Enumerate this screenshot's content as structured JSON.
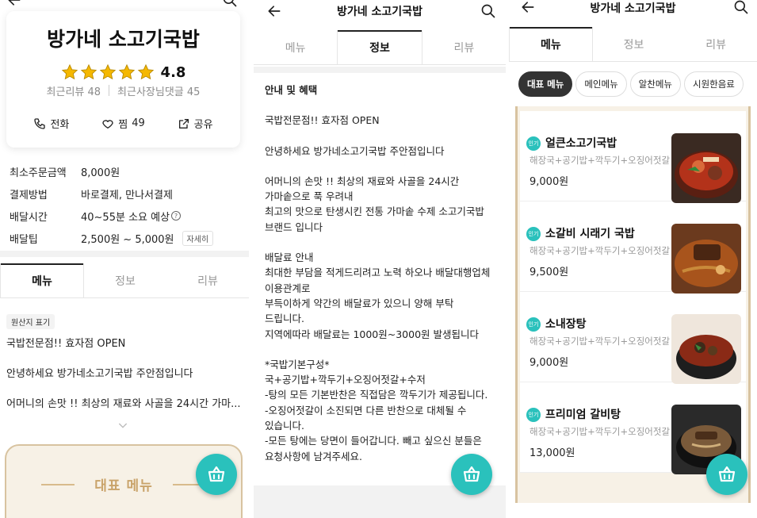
{
  "panel1": {
    "store_name": "방가네 소고기국밥",
    "rating": "4.8",
    "recent_reviews": "최근리뷰 48",
    "recent_owner_replies": "최근사장님댓글 45",
    "actions": {
      "call": "전화",
      "like": "찜",
      "like_count": "49",
      "share": "공유"
    },
    "info": [
      {
        "key": "최소주문금액",
        "value": "8,000원"
      },
      {
        "key": "결제방법",
        "value": "바로결제, 만나서결제"
      },
      {
        "key": "배달시간",
        "value": "40~55분 소요 예상"
      },
      {
        "key": "배달팁",
        "value": "2,500원 ~ 5,000원",
        "tag": "자세히"
      }
    ],
    "tabs": [
      "메뉴",
      "정보",
      "리뷰"
    ],
    "origin_tag": "원산지 표기",
    "notice": [
      "국밥전문점!!  효자점 OPEN",
      "안녕하세요 방가네소고기국밥  주안점입니다",
      "어머니의 손맛 !!  최상의 재료와 사골을 24시간 가마..."
    ],
    "banner_title": "대표 메뉴"
  },
  "panel2": {
    "header_title": "방가네 소고기국밥",
    "tabs": [
      "메뉴",
      "정보",
      "리뷰"
    ],
    "section_title": "안내 및 혜택",
    "paragraphs": [
      [
        "국밥전문점!!  효자점 OPEN"
      ],
      [
        "안녕하세요 방가네소고기국밥  주안점입니다"
      ],
      [
        "어머니의 손맛 !!  최상의 재료와 사골을 24시간",
        "가마솥으로 푹 우려내",
        "최고의 맛으로 탄생시킨 전통 가마솥 수제 소고기국밥",
        "브랜드 입니다"
      ],
      [
        "배달료 안내",
        "최대한 부담을 적게드리려고 노력 하오나 배달대행업체",
        "이용관계로",
        "부득이하게 약간의 배달료가 있으니 양해 부탁",
        "드립니다.",
        "지역에따라 배달료는 1000원~3000원 발생됩니다"
      ],
      [
        "*국밥기본구성*",
        "국+공기밥+깍두기+오징어젓갈+수저",
        "-탕의 모든 기본반찬은 직접담은 깍두기가 제공됩니다.",
        "-오징어젓갈이 소진되면 다른 반찬으로 대체될 수",
        "있습니다.",
        "-모든 탕에는 당면이 들어갑니다. 빼고 싶으신 분들은",
        "요청사항에 남겨주세요."
      ]
    ]
  },
  "panel3": {
    "header_title": "방가네 소고기국밥",
    "tabs": [
      "메뉴",
      "정보",
      "리뷰"
    ],
    "chips": [
      "대표 메뉴",
      "메인메뉴",
      "알찬메뉴",
      "시원한음료"
    ],
    "badge": "인기",
    "menu": [
      {
        "name": "얼큰소고기국밥",
        "desc": "해장국+공기밥+깍두기+오징어젓갈",
        "price": "9,000원"
      },
      {
        "name": "소갈비 시래기 국밥",
        "desc": "해장국+공기밥+깍두기+오징어젓갈",
        "price": "9,500원"
      },
      {
        "name": "소내장탕",
        "desc": "해장국+공기밥+깍두기+오징어젓갈",
        "price": "9,000원"
      },
      {
        "name": "프리미엄 갈비탕",
        "desc": "해장국+공기밥+깍두기+오징어젓갈",
        "price": "13,000원"
      }
    ]
  },
  "colors": {
    "accent": "#2ac1bc",
    "star": "#f5b800",
    "banner_bg": "#f7f1e6",
    "banner_border": "#d8c3a0"
  },
  "icons": [
    "back-arrow-icon",
    "search-icon",
    "star-icon",
    "phone-icon",
    "heart-icon",
    "share-icon",
    "chevron-down-icon",
    "basket-icon"
  ]
}
